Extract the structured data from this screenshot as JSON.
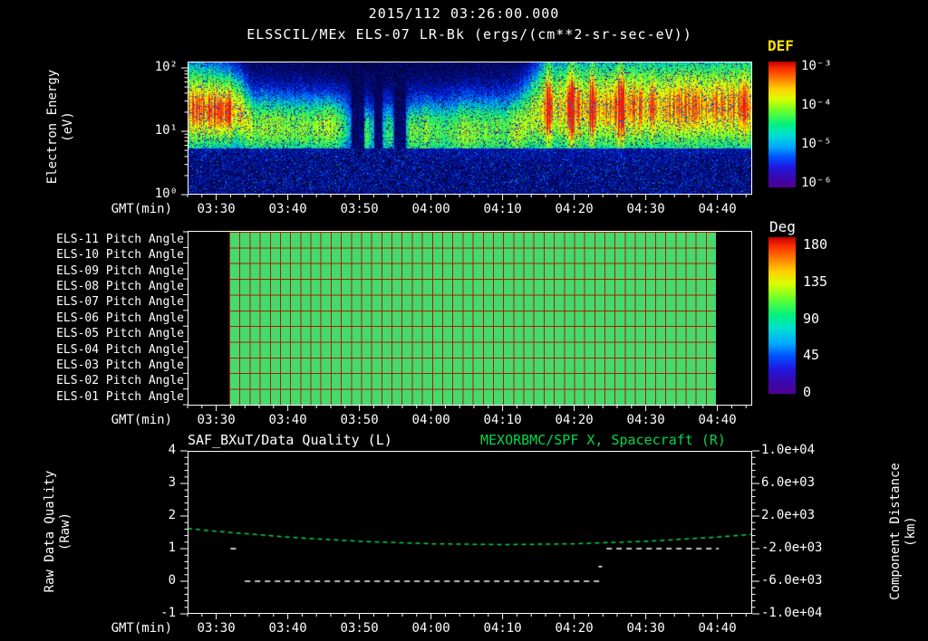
{
  "title": "2015/112 03:26:00.000",
  "colors": {
    "background": "#000000",
    "accent_green": "#00d84a",
    "def_label": "#ffe000",
    "pitch_green": "#46d96e",
    "grid_red": "#a32400"
  },
  "spectrogram_panel": {
    "title": "ELSSCIL/MEx ELS-07 LR-Bk  (ergs/(cm**2-sr-sec-eV))",
    "y_axis": {
      "label_line1": "Electron Energy",
      "label_line2": "(eV)",
      "ticks": [
        "10²",
        "10¹",
        "10⁰"
      ]
    },
    "x_axis": {
      "label": "GMT(min)",
      "ticks": [
        "03:30",
        "03:40",
        "03:50",
        "04:00",
        "04:10",
        "04:20",
        "04:30",
        "04:40"
      ]
    },
    "colorbar": {
      "title": "DEF",
      "ticks": [
        "10⁻³",
        "10⁻⁴",
        "10⁻⁵",
        "10⁻⁶"
      ]
    }
  },
  "pitch_panel": {
    "rows": [
      "ELS-11 Pitch Angle",
      "ELS-10 Pitch Angle",
      "ELS-09 Pitch Angle",
      "ELS-08 Pitch Angle",
      "ELS-07 Pitch Angle",
      "ELS-06 Pitch Angle",
      "ELS-05 Pitch Angle",
      "ELS-04 Pitch Angle",
      "ELS-03 Pitch Angle",
      "ELS-02 Pitch Angle",
      "ELS-01 Pitch Angle"
    ],
    "x_axis": {
      "label": "GMT(min)",
      "ticks": [
        "03:30",
        "03:40",
        "03:50",
        "04:00",
        "04:10",
        "04:20",
        "04:30",
        "04:40"
      ]
    },
    "colorbar": {
      "title": "Deg",
      "ticks": [
        "180",
        "135",
        "90",
        "45",
        "0"
      ]
    }
  },
  "timeseries_panel": {
    "title_left": "SAF_BXuT/Data Quality (L)",
    "title_right": "MEXORBMC/SPF X, Spacecraft (R)",
    "left_axis": {
      "label_line1": "Raw Data Quality",
      "label_line2": "(Raw)",
      "ticks": [
        "4",
        "3",
        "2",
        "1",
        "0",
        "-1"
      ]
    },
    "right_axis": {
      "label_line1": "Component Distance",
      "label_line2": "(km)",
      "ticks": [
        "1.0e+04",
        "6.0e+03",
        "2.0e+03",
        "-2.0e+03",
        "-6.0e+03",
        "-1.0e+04"
      ]
    },
    "x_axis": {
      "label": "GMT(min)",
      "ticks": [
        "03:30",
        "03:40",
        "03:50",
        "04:00",
        "04:10",
        "04:20",
        "04:30",
        "04:40"
      ]
    }
  },
  "chart_data": [
    {
      "type": "heatmap",
      "name": "electron_energy_spectrogram",
      "title": "ELSSCIL/MEx ELS-07 LR-Bk",
      "units": "ergs/(cm**2-sr-sec-eV)",
      "x_start": "03:26",
      "x_end": "04:45",
      "y_scale": "log",
      "y_range_ev": [
        1,
        126
      ],
      "z_range": [
        1e-06,
        0.001
      ],
      "band_ev": [
        5,
        100
      ],
      "intensity_profile": [
        [
          0,
          0.8
        ],
        [
          6,
          0.85
        ],
        [
          9,
          0.58
        ],
        [
          14,
          0.55
        ],
        [
          20,
          0.6
        ],
        [
          22,
          0.4
        ],
        [
          23.5,
          0.12
        ],
        [
          25,
          0.5
        ],
        [
          26.5,
          0.14
        ],
        [
          28,
          0.48
        ],
        [
          29.5,
          0.12
        ],
        [
          31,
          0.5
        ],
        [
          33,
          0.55
        ],
        [
          36,
          0.45
        ],
        [
          38,
          0.58
        ],
        [
          41,
          0.52
        ],
        [
          44,
          0.5
        ],
        [
          46,
          0.62
        ],
        [
          48,
          0.6
        ],
        [
          50,
          0.78
        ],
        [
          52,
          0.68
        ],
        [
          54,
          0.8
        ],
        [
          56,
          0.72
        ],
        [
          58,
          0.76
        ],
        [
          62,
          0.8
        ],
        [
          66,
          0.76
        ],
        [
          70,
          0.8
        ],
        [
          74,
          0.78
        ],
        [
          79,
          0.82
        ]
      ],
      "gaps_min": [
        [
          22.8,
          24.6
        ],
        [
          26.0,
          27.2
        ],
        [
          28.8,
          30.4
        ]
      ],
      "center_log_ev": [
        [
          0,
          1.35
        ],
        [
          7,
          1.3
        ],
        [
          9,
          1.05
        ],
        [
          22,
          1.05
        ],
        [
          24,
          0.95
        ],
        [
          46,
          1.0
        ],
        [
          50,
          1.35
        ],
        [
          79,
          1.4
        ]
      ],
      "sigma_log": [
        [
          0,
          0.5
        ],
        [
          8,
          0.38
        ],
        [
          24,
          0.33
        ],
        [
          46,
          0.4
        ],
        [
          50,
          0.55
        ],
        [
          79,
          0.55
        ]
      ],
      "bright_streaks_min": [
        50.5,
        53.5,
        56.5,
        60.5
      ]
    },
    {
      "type": "heatmap",
      "name": "pitch_angles",
      "rows": [
        "ELS-11",
        "ELS-10",
        "ELS-09",
        "ELS-08",
        "ELS-07",
        "ELS-06",
        "ELS-05",
        "ELS-04",
        "ELS-03",
        "ELS-02",
        "ELS-01"
      ],
      "value_deg": 95,
      "data_start": "03:32",
      "data_end": "04:40",
      "z_range_deg": [
        0,
        180
      ]
    },
    {
      "type": "line",
      "name": "quality_and_distance",
      "x_start": "03:26",
      "x_end": "04:45",
      "left_ylim": [
        -1,
        4
      ],
      "right_ylim": [
        -10000,
        10000
      ],
      "series": [
        {
          "name": "MEXORBMC/SPF X, Spacecraft (R)",
          "axis": "right",
          "style": "dashed",
          "color": "#00d84a",
          "t_min": [
            0,
            4,
            14,
            24,
            34,
            44,
            54,
            64,
            74,
            79
          ],
          "km": [
            480,
            130,
            -590,
            -1110,
            -1420,
            -1520,
            -1420,
            -1110,
            -590,
            -240
          ]
        },
        {
          "name": "SAF_BXuT/Data Quality (L)",
          "axis": "left",
          "style": "dashed",
          "color": "#ffffff",
          "segments": [
            {
              "y": 1,
              "t0": 6.0,
              "t1": 7.2
            },
            {
              "y": 0,
              "t0": 8.0,
              "t1": 57.5
            },
            {
              "y": 0.45,
              "t0": 57.4,
              "t1": 57.9
            },
            {
              "y": 1,
              "t0": 58.5,
              "t1": 74.2
            }
          ]
        }
      ]
    }
  ]
}
